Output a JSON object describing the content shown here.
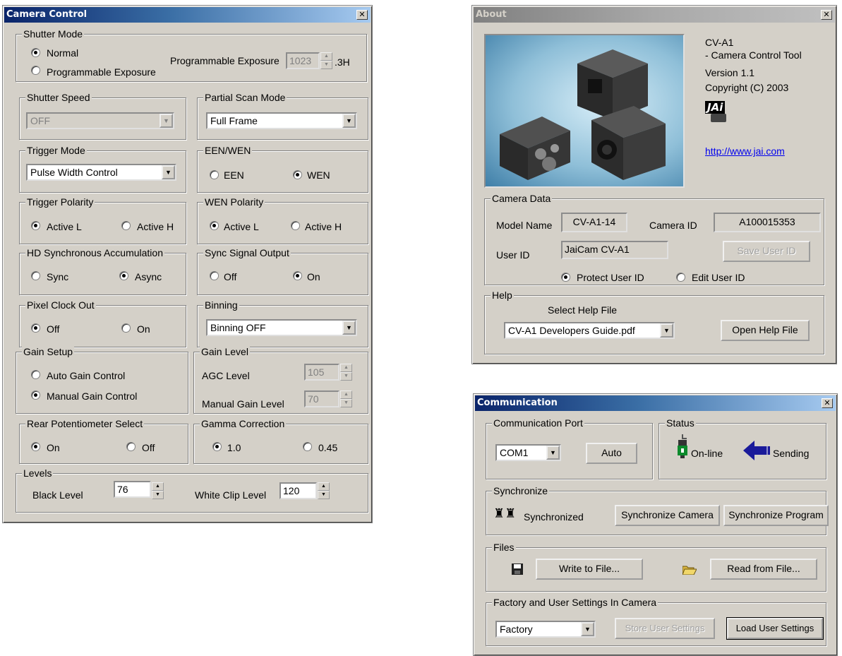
{
  "camera_control": {
    "title": "Camera Control",
    "close": "✕",
    "shutter_mode": {
      "legend": "Shutter Mode",
      "normal": "Normal",
      "programmable": "Programmable Exposure",
      "prog_label": "Programmable Exposure",
      "prog_value": "1023",
      "prog_unit": ".3H"
    },
    "shutter_speed": {
      "legend": "Shutter Speed",
      "value": "OFF"
    },
    "partial_scan": {
      "legend": "Partial Scan Mode",
      "value": "Full Frame"
    },
    "trigger_mode": {
      "legend": "Trigger Mode",
      "value": "Pulse Width Control"
    },
    "een_wen": {
      "legend": "EEN/WEN",
      "een": "EEN",
      "wen": "WEN"
    },
    "trigger_polarity": {
      "legend": "Trigger Polarity",
      "active_l": "Active L",
      "active_h": "Active H"
    },
    "wen_polarity": {
      "legend": "WEN Polarity",
      "active_l": "Active L",
      "active_h": "Active H"
    },
    "hd_sync": {
      "legend": "HD Synchronous Accumulation",
      "sync": "Sync",
      "async": "Async"
    },
    "sync_signal": {
      "legend": "Sync Signal Output",
      "off": "Off",
      "on": "On"
    },
    "pixel_clock": {
      "legend": "Pixel Clock Out",
      "off": "Off",
      "on": "On"
    },
    "binning": {
      "legend": "Binning",
      "value": "Binning OFF"
    },
    "gain_setup": {
      "legend": "Gain Setup",
      "auto": "Auto Gain Control",
      "manual": "Manual Gain Control"
    },
    "gain_level": {
      "legend": "Gain Level",
      "agc_label": "AGC Level",
      "agc_value": "105",
      "manual_label": "Manual Gain Level",
      "manual_value": "70"
    },
    "rear_pot": {
      "legend": "Rear Potentiometer Select",
      "on": "On",
      "off": "Off"
    },
    "gamma": {
      "legend": "Gamma Correction",
      "g1": "1.0",
      "g045": "0.45"
    },
    "levels": {
      "legend": "Levels",
      "black_label": "Black Level",
      "black_value": "76",
      "white_label": "White Clip Level",
      "white_value": "120"
    }
  },
  "about": {
    "title": "About",
    "close": "✕",
    "product": "CV-A1",
    "tool": "- Camera Control Tool",
    "version": "Version 1.1",
    "copyright": "Copyright (C) 2003",
    "logo_text": "JAi",
    "url": "http://www.jai.com",
    "camera_data": {
      "legend": "Camera Data",
      "model_label": "Model Name",
      "model_value": "CV-A1-14",
      "id_label": "Camera ID",
      "id_value": "A100015353",
      "user_label": "User ID",
      "user_value": "JaiCam CV-A1",
      "save_btn": "Save User ID",
      "protect": "Protect User ID",
      "edit": "Edit User ID"
    },
    "help": {
      "legend": "Help",
      "select_label": "Select Help File",
      "file_value": "CV-A1 Developers Guide.pdf",
      "open_btn": "Open Help File"
    }
  },
  "communication": {
    "title": "Communication",
    "close": "✕",
    "port": {
      "legend": "Communication Port",
      "value": "COM1",
      "auto_btn": "Auto"
    },
    "status": {
      "legend": "Status",
      "online": "On-line",
      "sending": "Sending"
    },
    "synchronize": {
      "legend": "Synchronize",
      "label": "Synchronized",
      "cam_btn": "Synchronize Camera",
      "prog_btn": "Synchronize Program"
    },
    "files": {
      "legend": "Files",
      "write_btn": "Write to File...",
      "read_btn": "Read from File..."
    },
    "factory": {
      "legend": "Factory and User Settings In Camera",
      "value": "Factory",
      "store_btn": "Store User Settings",
      "load_btn": "Load User Settings"
    }
  }
}
